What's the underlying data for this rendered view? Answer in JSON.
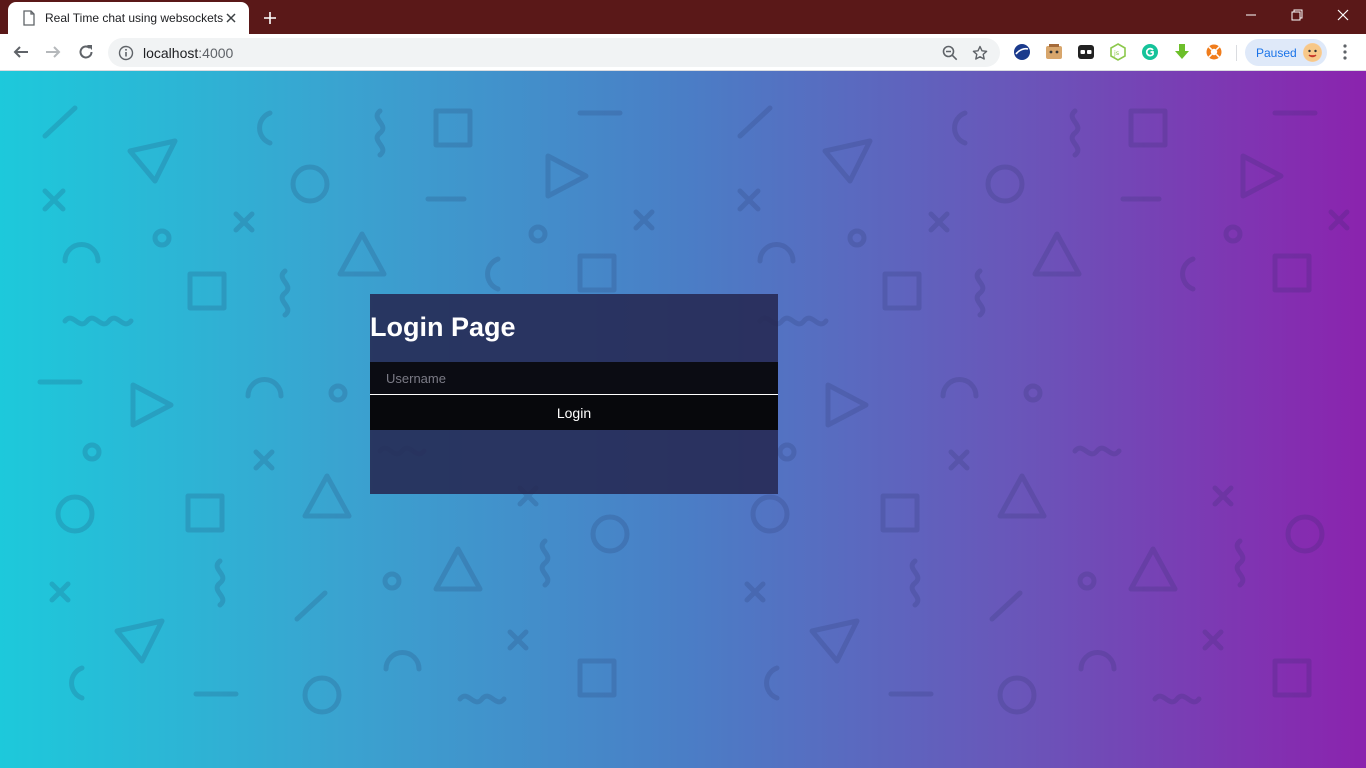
{
  "browser": {
    "tab": {
      "title": "Real Time chat using websockets"
    },
    "url": {
      "host": "localhost",
      "port": ":4000"
    },
    "profile": {
      "label": "Paused"
    }
  },
  "login": {
    "title": "Login Page",
    "username_placeholder": "Username",
    "button_label": "Login"
  },
  "colors": {
    "tab_strip": "#5a1818",
    "gradient_start": "#1dc9db",
    "gradient_end": "#8b23ae",
    "card_bg": "#262852",
    "input_bg": "#0b0c13"
  }
}
